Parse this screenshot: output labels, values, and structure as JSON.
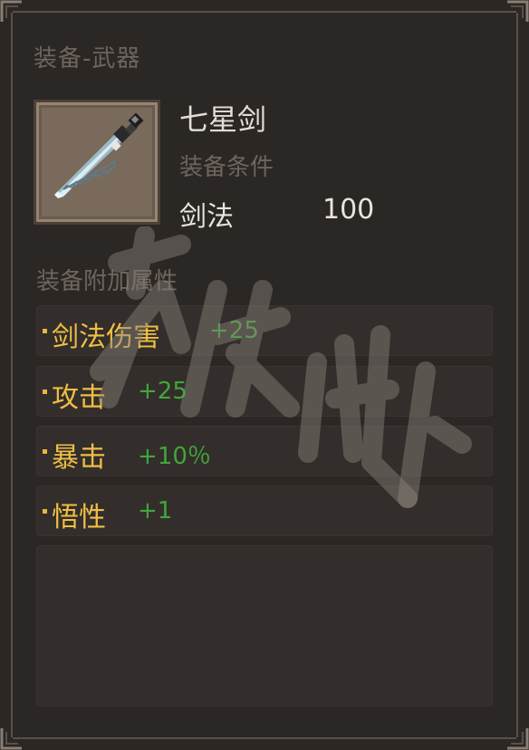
{
  "panel": {
    "section_title": "装备-武器",
    "item": {
      "name": "七星剑",
      "icon": "sword-icon"
    },
    "requirement": {
      "title": "装备条件",
      "name": "剑法",
      "value": "100"
    },
    "bonus_title": "装备附加属性",
    "attributes": [
      {
        "name": "剑法伤害",
        "value": "+25"
      },
      {
        "name": "攻击",
        "value": "+25"
      },
      {
        "name": "暴击",
        "value": "+10％"
      },
      {
        "name": "悟性",
        "value": "+1"
      }
    ]
  },
  "colors": {
    "attr_name": "#efbe44",
    "attr_value": "#3fa73b",
    "muted_text": "#6e655c"
  }
}
